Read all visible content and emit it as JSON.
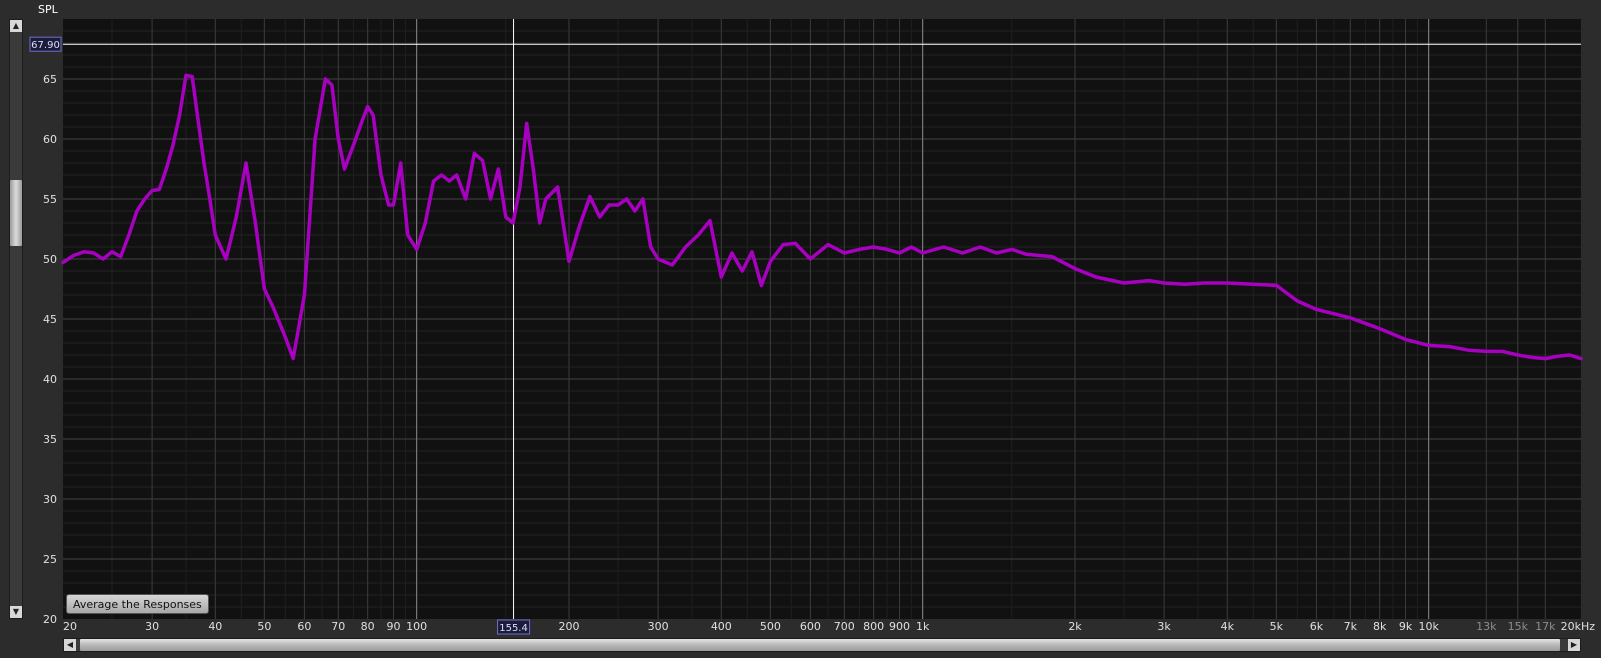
{
  "chart_data": {
    "type": "line",
    "title": "",
    "ylabel": "SPL",
    "xlabel": "",
    "x_scale": "log",
    "xlim": [
      20,
      20000
    ],
    "ylim": [
      20,
      70
    ],
    "grid": true,
    "y_ticks": [
      "20",
      "25",
      "30",
      "35",
      "40",
      "45",
      "50",
      "55",
      "60",
      "65"
    ],
    "x_ticks": [
      {
        "v": 20,
        "label": "20"
      },
      {
        "v": 30,
        "label": "30"
      },
      {
        "v": 40,
        "label": "40"
      },
      {
        "v": 50,
        "label": "50"
      },
      {
        "v": 60,
        "label": "60"
      },
      {
        "v": 70,
        "label": "70"
      },
      {
        "v": 80,
        "label": "80"
      },
      {
        "v": 90,
        "label": "90"
      },
      {
        "v": 100,
        "label": "100"
      },
      {
        "v": 200,
        "label": "200"
      },
      {
        "v": 300,
        "label": "300"
      },
      {
        "v": 400,
        "label": "400"
      },
      {
        "v": 500,
        "label": "500"
      },
      {
        "v": 600,
        "label": "600"
      },
      {
        "v": 700,
        "label": "700"
      },
      {
        "v": 800,
        "label": "800"
      },
      {
        "v": 900,
        "label": "900"
      },
      {
        "v": 1000,
        "label": "1k"
      },
      {
        "v": 2000,
        "label": "2k"
      },
      {
        "v": 3000,
        "label": "3k"
      },
      {
        "v": 4000,
        "label": "4k"
      },
      {
        "v": 5000,
        "label": "5k"
      },
      {
        "v": 6000,
        "label": "6k"
      },
      {
        "v": 7000,
        "label": "7k"
      },
      {
        "v": 8000,
        "label": "8k"
      },
      {
        "v": 9000,
        "label": "9k"
      },
      {
        "v": 10000,
        "label": "10k"
      },
      {
        "v": 13000,
        "label": "13k",
        "dim": true
      },
      {
        "v": 15000,
        "label": "15k",
        "dim": true
      },
      {
        "v": 17000,
        "label": "17k",
        "dim": true
      },
      {
        "v": 20000,
        "label": "20kHz"
      }
    ],
    "cursor": {
      "x": 155.4,
      "x_label": "155.4",
      "y": 67.9,
      "y_label": "67.90"
    },
    "series_color": "#a800c0",
    "series": [
      {
        "x": [
          20,
          21,
          22,
          23,
          24,
          25,
          26,
          27,
          28,
          29,
          30,
          31,
          32,
          33,
          34,
          35,
          36,
          37,
          38,
          39,
          40,
          42,
          44,
          46,
          48,
          50,
          52,
          55,
          57,
          60,
          63,
          66,
          68,
          70,
          72,
          75,
          78,
          80,
          82,
          85,
          88,
          90,
          93,
          96,
          100,
          104,
          108,
          112,
          116,
          120,
          125,
          130,
          135,
          140,
          145,
          150,
          155,
          160,
          165,
          170,
          175,
          180,
          190,
          200,
          210,
          220,
          230,
          240,
          250,
          260,
          270,
          280,
          290,
          300,
          320,
          340,
          360,
          380,
          400,
          420,
          440,
          460,
          480,
          500,
          530,
          560,
          600,
          650,
          700,
          750,
          800,
          850,
          900,
          950,
          1000,
          1100,
          1200,
          1300,
          1400,
          1500,
          1600,
          1800,
          2000,
          2200,
          2500,
          2800,
          3000,
          3300,
          3600,
          4000,
          4500,
          5000,
          5500,
          6000,
          7000,
          8000,
          9000,
          10000,
          11000,
          12000,
          13000,
          14000,
          15000,
          16000,
          17000,
          18000,
          19000,
          20000
        ],
        "y": [
          49.7,
          50.3,
          50.6,
          50.5,
          50.0,
          50.6,
          50.2,
          52.0,
          54.0,
          55.0,
          55.7,
          55.8,
          57.5,
          59.5,
          62.0,
          65.3,
          65.2,
          61.5,
          58.0,
          55.0,
          52.0,
          50.0,
          53.5,
          58.0,
          53.0,
          47.5,
          46.0,
          43.5,
          41.7,
          47.0,
          60.0,
          65.0,
          64.5,
          60.0,
          57.5,
          59.5,
          61.5,
          62.7,
          62.0,
          57.0,
          54.5,
          54.5,
          58.0,
          52.0,
          50.8,
          53.0,
          56.5,
          57.0,
          56.5,
          57.0,
          55.0,
          58.8,
          58.2,
          55.0,
          57.5,
          53.5,
          53.0,
          56.0,
          61.3,
          57.5,
          53.0,
          55.0,
          56.0,
          49.8,
          52.8,
          55.2,
          53.5,
          54.5,
          54.5,
          55.0,
          54.0,
          55.0,
          51.0,
          50.0,
          49.5,
          51.0,
          52.0,
          53.2,
          48.5,
          50.5,
          49.0,
          50.6,
          47.8,
          49.8,
          51.2,
          51.3,
          50.0,
          51.2,
          50.5,
          50.8,
          51.0,
          50.8,
          50.5,
          51.0,
          50.5,
          51.0,
          50.5,
          51.0,
          50.5,
          50.8,
          50.4,
          50.2,
          49.2,
          48.5,
          48.0,
          48.2,
          48.0,
          47.9,
          48.0,
          48.0,
          47.9,
          47.8,
          46.5,
          45.8,
          45.1,
          44.2,
          43.3,
          42.8,
          42.7,
          42.4,
          42.3,
          42.3,
          42.0,
          41.8,
          41.7,
          41.9,
          42.0,
          41.7
        ]
      }
    ]
  },
  "ui": {
    "average_button_label": "Average the Responses"
  }
}
